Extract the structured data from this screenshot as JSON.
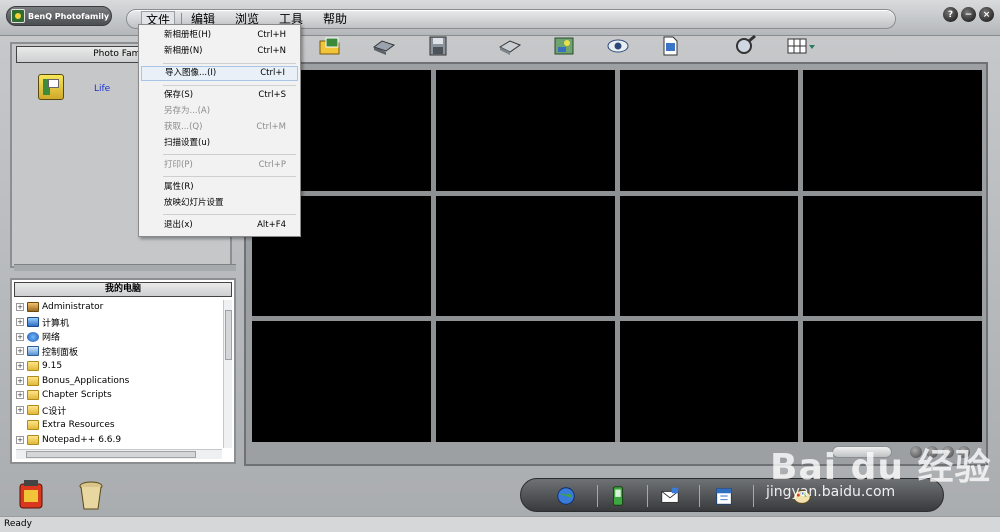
{
  "app": {
    "title": "BenQ Photofamily",
    "window_buttons": [
      "?",
      "−",
      "×"
    ]
  },
  "menubar": {
    "items": [
      "文件",
      "编辑",
      "浏览",
      "工具",
      "帮助"
    ]
  },
  "file_menu": {
    "items": [
      {
        "label": "新相册柜(H)",
        "shortcut": "Ctrl+H",
        "disabled": false
      },
      {
        "label": "新相册(N)",
        "shortcut": "Ctrl+N",
        "disabled": false
      },
      {
        "label": "导入图像...(I)",
        "shortcut": "Ctrl+I",
        "disabled": false,
        "highlighted": true
      },
      {
        "label": "保存(S)",
        "shortcut": "Ctrl+S",
        "disabled": false
      },
      {
        "label": "另存为...(A)",
        "shortcut": "",
        "disabled": true
      },
      {
        "label": "获取...(Q)",
        "shortcut": "Ctrl+M",
        "disabled": true
      },
      {
        "label": "扫描设置(u)",
        "shortcut": "",
        "disabled": false
      },
      {
        "label": "打印(P)",
        "shortcut": "Ctrl+P",
        "disabled": true
      },
      {
        "label": "属性(R)",
        "shortcut": "",
        "disabled": false
      },
      {
        "label": "放映幻灯片设置",
        "shortcut": "",
        "disabled": false
      },
      {
        "label": "退出(x)",
        "shortcut": "Alt+F4",
        "disabled": false
      }
    ]
  },
  "album_panel": {
    "header": "Photo Family",
    "items": [
      {
        "label": "Life",
        "icon": "album-cabinet-icon"
      }
    ]
  },
  "tree_panel": {
    "header": "我的电脑",
    "items": [
      {
        "label": "Administrator",
        "icon": "user-folder-icon",
        "expandable": true
      },
      {
        "label": "计算机",
        "icon": "computer-icon",
        "expandable": true
      },
      {
        "label": "网络",
        "icon": "network-icon",
        "expandable": true
      },
      {
        "label": "控制面板",
        "icon": "control-panel-icon",
        "expandable": true
      },
      {
        "label": "9.15",
        "icon": "folder-icon",
        "expandable": true
      },
      {
        "label": "Bonus_Applications",
        "icon": "folder-icon",
        "expandable": true
      },
      {
        "label": "Chapter Scripts",
        "icon": "folder-icon",
        "expandable": true
      },
      {
        "label": "C设计",
        "icon": "folder-icon",
        "expandable": true
      },
      {
        "label": "Extra Resources",
        "icon": "folder-icon",
        "expandable": false
      },
      {
        "label": "Notepad++ 6.6.9",
        "icon": "folder-icon",
        "expandable": true
      }
    ]
  },
  "status": {
    "text": "Ready"
  },
  "watermark": {
    "big": "Bai du 经验",
    "small": "jingyan.baidu.com"
  },
  "colors": {
    "background": "#b9bcbf",
    "thumbnail_cell": "#000000",
    "link_blue": "#1a33d6"
  }
}
